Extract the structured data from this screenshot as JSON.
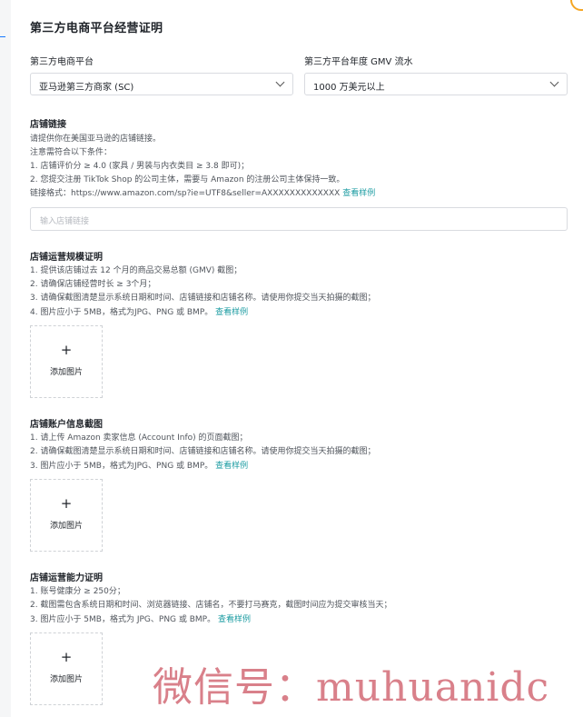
{
  "page_title": "第三方电商平台经营证明",
  "platform": {
    "label": "第三方电商平台",
    "value": "亚马逊第三方商家 (SC)"
  },
  "gmv": {
    "label": "第三方平台年度 GMV 流水",
    "value": "1000 万美元以上"
  },
  "store_link": {
    "title": "店铺链接",
    "lines": [
      "请提供你在美国亚马逊的店铺链接。",
      "注意需符合以下条件：",
      "1. 店铺评价分 ≥ 4.0 (家具 / 男装与内衣类目 ≥ 3.8 即可)；",
      "2. 您提交注册 TikTok Shop 的公司主体，需要与 Amazon 的注册公司主体保持一致。"
    ],
    "format_text": "链接格式：https://www.amazon.com/sp?ie=UTF8&seller=AXXXXXXXXXXXXX",
    "sample_link": "查看样例",
    "input_placeholder": "输入店铺链接"
  },
  "scale_proof": {
    "title": "店铺运营规模证明",
    "lines": [
      "1. 提供该店铺过去 12 个月的商品交易总额 (GMV) 截图；",
      "2. 请确保店铺经营时长 ≥ 3个月；",
      "3. 请确保截图清楚显示系统日期和时间、店铺链接和店铺名称。请使用你提交当天拍摄的截图；",
      "4. 图片应小于 5MB，格式为JPG、PNG 或 BMP。"
    ],
    "sample_link": "查看样例",
    "upload_plus": "+",
    "upload_label": "添加图片"
  },
  "account_info": {
    "title": "店铺账户信息截图",
    "lines": [
      "1. 请上传 Amazon 卖家信息 (Account Info) 的页面截图；",
      "2. 请确保截图清楚显示系统日期和时间、店铺链接和店铺名称。请使用你提交当天拍摄的截图；",
      "3. 图片应小于 5MB，格式为JPG、PNG 或 BMP。"
    ],
    "sample_link": "查看样例",
    "upload_plus": "+",
    "upload_label": "添加图片"
  },
  "capability": {
    "title": "店铺运营能力证明",
    "lines": [
      "1. 账号健康分 ≥ 250分；",
      "2. 截图需包含系统日期和时间、浏览器链接、店铺名，不要打马赛克，截图时间应为提交审核当天；",
      "3. 图片应小于 5MB，格式为 JPG、PNG 或 BMP。"
    ],
    "sample_link": "查看样例",
    "upload_plus": "+",
    "upload_label": "添加图片"
  },
  "watermark": "微信号：muhuanidc",
  "colors": {
    "link": "#1a9ba1",
    "watermark": "#d9808a",
    "border": "#d9dbe0"
  }
}
